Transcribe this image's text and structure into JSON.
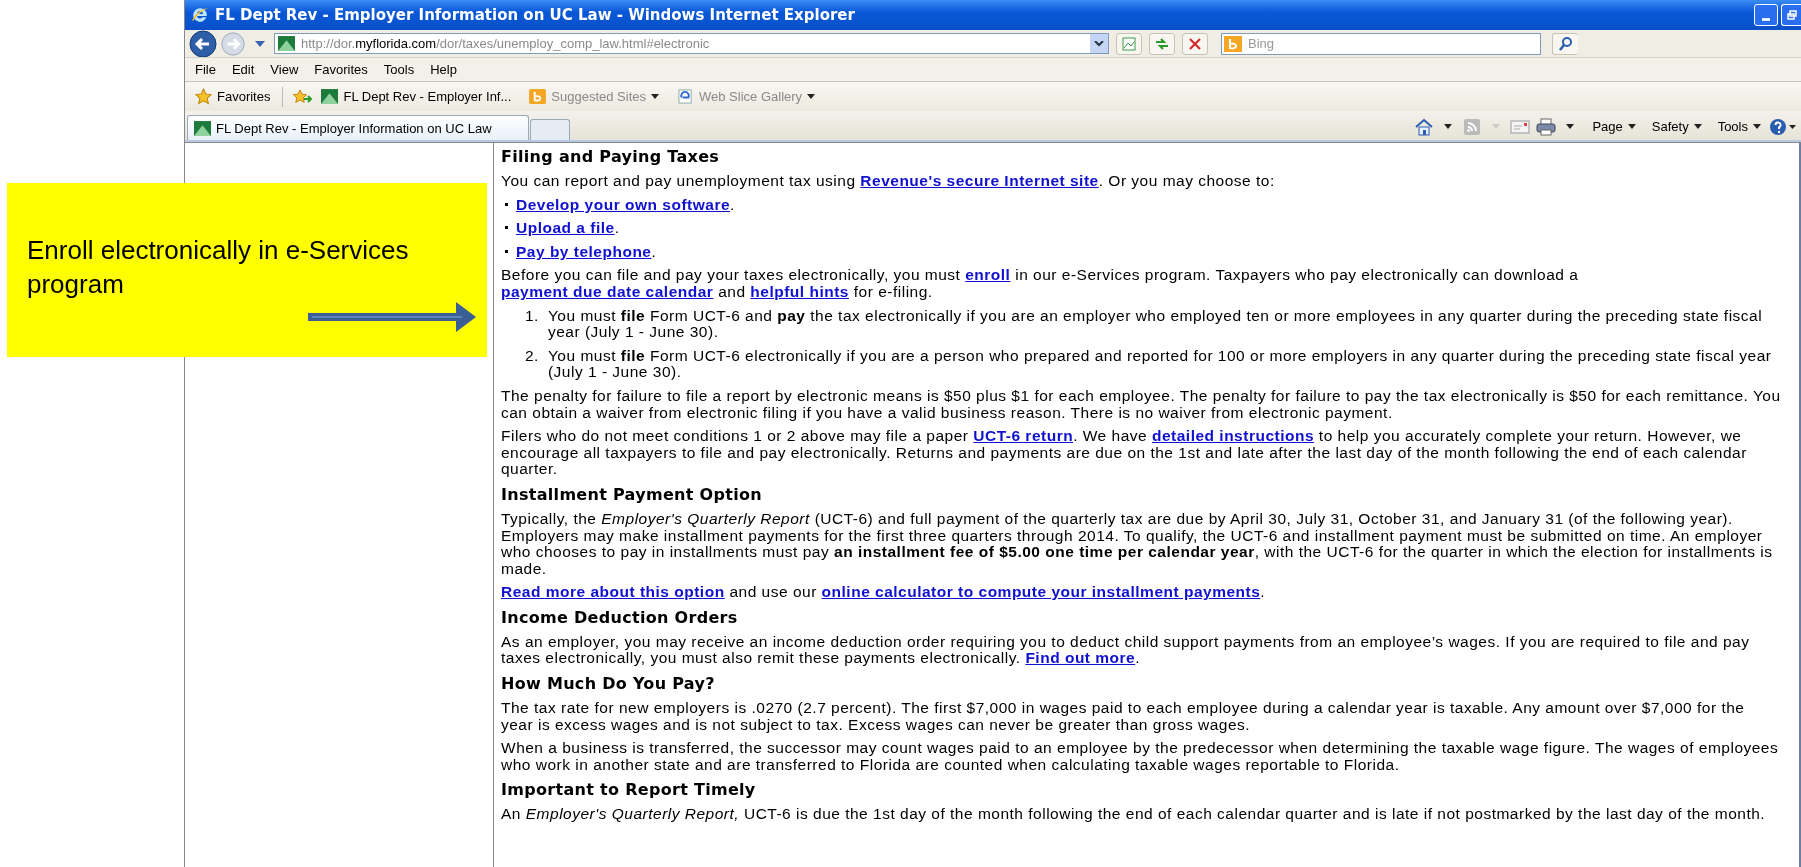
{
  "window": {
    "title": "FL Dept Rev - Employer Information on UC Law - Windows Internet Explorer"
  },
  "address_bar": {
    "url": "http://dor.**myflorida.com**/dor/taxes/unemploy_comp_law.html#electronic",
    "search_placeholder": "Bing"
  },
  "menu": [
    "File",
    "Edit",
    "View",
    "Favorites",
    "Tools",
    "Help"
  ],
  "favorites_bar": {
    "label": "Favorites",
    "items": [
      {
        "kind": "site",
        "label": "FL Dept Rev - Employer Inf...",
        "dropdown": false
      },
      {
        "kind": "suggested",
        "label": "Suggested Sites",
        "dropdown": true
      },
      {
        "kind": "slice",
        "label": "Web Slice Gallery",
        "dropdown": true
      }
    ]
  },
  "tabs": [
    {
      "label": "FL Dept Rev - Employer Information on UC Law",
      "selected": true
    }
  ],
  "command_bar": [
    "Page",
    "Safety",
    "Tools"
  ],
  "content": [
    {
      "kind": "heading",
      "text": "Filing and Paying Taxes"
    },
    {
      "kind": "paragraph",
      "parts": [
        {
          "kind": "text",
          "text": "You can report and pay unemployment tax using "
        },
        {
          "kind": "link",
          "text": "Revenue's secure Internet site"
        },
        {
          "kind": "text",
          "text": ". Or you may choose to:"
        }
      ]
    },
    {
      "kind": "bullet",
      "parts": [
        {
          "kind": "link",
          "text": "Develop your own software"
        },
        {
          "kind": "text",
          "text": "."
        }
      ]
    },
    {
      "kind": "bullet",
      "parts": [
        {
          "kind": "link",
          "text": "Upload a file"
        },
        {
          "kind": "text",
          "text": "."
        }
      ]
    },
    {
      "kind": "bullet",
      "parts": [
        {
          "kind": "link",
          "text": "Pay by telephone"
        },
        {
          "kind": "text",
          "text": "."
        }
      ]
    },
    {
      "kind": "paragraph",
      "parts": [
        {
          "kind": "text",
          "text": "Before you can file and pay your taxes electronically, you must "
        },
        {
          "kind": "link",
          "text": "enroll"
        },
        {
          "kind": "text",
          "text": " in our e-Services program. Taxpayers who pay electronically can download a "
        },
        {
          "kind": "link",
          "text": "payment due date calendar"
        },
        {
          "kind": "text",
          "text": " and "
        },
        {
          "kind": "link",
          "text": "helpful hints"
        },
        {
          "kind": "text",
          "text": " for e-filing."
        }
      ]
    },
    {
      "kind": "numbered",
      "number": "1.",
      "parts": [
        {
          "kind": "text",
          "text": "You must **file** Form UCT-6 and **pay** the tax electronically if you are an employer who employed ten or more employees in any quarter during the preceding state fiscal year (July 1 - June 30)."
        }
      ]
    },
    {
      "kind": "numbered",
      "number": "2.",
      "parts": [
        {
          "kind": "text",
          "text": "You must **file** Form UCT-6 electronically if you are a person who prepared and reported for 100 or more employers in any quarter during the preceding state fiscal year (July 1 - June 30)."
        }
      ]
    },
    {
      "kind": "paragraph",
      "parts": [
        {
          "kind": "text",
          "text": "The penalty for failure to file a report by electronic means is $50 plus $1 for each employee. The penalty for failure to pay the tax electronically is $50 for each remittance. You can obtain a waiver from electronic filing if you have a valid business reason. There is no waiver from electronic payment."
        }
      ]
    },
    {
      "kind": "paragraph",
      "parts": [
        {
          "kind": "text",
          "text": "Filers who do not meet conditions 1 or 2 above may file a paper "
        },
        {
          "kind": "link",
          "text": "UCT-6 return"
        },
        {
          "kind": "text",
          "text": ". We have "
        },
        {
          "kind": "link",
          "text": "detailed instructions"
        },
        {
          "kind": "text",
          "text": " to help you accurately complete your return. However, we encourage all taxpayers to file and pay electronically. Returns and payments are due on the 1st and late after the last day of the month following the end of each calendar quarter."
        }
      ]
    },
    {
      "kind": "heading",
      "text": "Installment Payment Option"
    },
    {
      "kind": "paragraph",
      "parts": [
        {
          "kind": "text",
          "text": "Typically, the *Employer's Quarterly Report* (UCT-6) and full payment of the quarterly tax are due by April 30, July 31, October 31, and January 31 (of the following year). Employers may make installment payments for the first three quarters through 2014. To qualify, the UCT-6 and installment payment must be submitted on time. An employer who chooses to pay in installments must pay **an installment fee of $5.00 one time per calendar year**, with the UCT-6 for the quarter in which the election for installments is made."
        }
      ]
    },
    {
      "kind": "paragraph",
      "parts": [
        {
          "kind": "link",
          "text": "Read more about this option"
        },
        {
          "kind": "text",
          "text": " and use our "
        },
        {
          "kind": "link",
          "text": "online calculator to compute your installment payments"
        },
        {
          "kind": "text",
          "text": "."
        }
      ]
    },
    {
      "kind": "heading",
      "text": "Income Deduction Orders"
    },
    {
      "kind": "paragraph",
      "parts": [
        {
          "kind": "text",
          "text": "As an employer, you may receive an income deduction order requiring you to deduct child support payments from an employee’s wages. If you are required to file and pay taxes electronically, you must also remit these payments electronically. "
        },
        {
          "kind": "link",
          "text": "Find out more"
        },
        {
          "kind": "text",
          "text": "."
        }
      ]
    },
    {
      "kind": "heading",
      "text": "How Much Do You Pay?"
    },
    {
      "kind": "paragraph",
      "parts": [
        {
          "kind": "text",
          "text": "The tax rate for new employers is .0270 (2.7 percent). The first $7,000 in wages paid to each employee during a calendar year is taxable. Any amount over $7,000 for the year is excess wages and is not subject to tax. Excess wages can never be greater than gross wages."
        }
      ]
    },
    {
      "kind": "paragraph",
      "parts": [
        {
          "kind": "text",
          "text": "When a business is transferred, the successor may count wages paid to an employee by the predecessor when determining the taxable wage figure. The wages of employees who work in another state and are transferred to Florida are counted when calculating taxable wages reportable to Florida."
        }
      ]
    },
    {
      "kind": "heading",
      "text": "Important to Report Timely"
    },
    {
      "kind": "paragraph",
      "parts": [
        {
          "kind": "text",
          "text": "An *Employer's Quarterly Report,* UCT-6 is due the 1st day of the month following the end of each calendar quarter and is late if not postmarked by the last day of the month."
        }
      ]
    }
  ],
  "callout": {
    "text": "Enroll electronically in e-Services program"
  }
}
